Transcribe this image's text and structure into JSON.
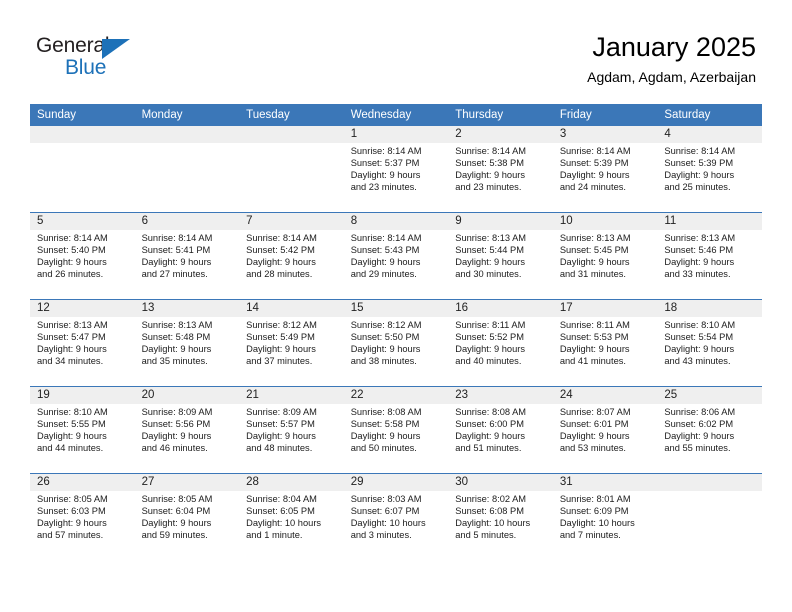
{
  "brand": {
    "name_part1": "General",
    "name_part2": "Blue",
    "triangle_color": "#1d71b8",
    "accent_color": "#3b77b8"
  },
  "header": {
    "title": "January 2025",
    "subtitle": "Agdam, Agdam, Azerbaijan"
  },
  "weekdays": [
    "Sunday",
    "Monday",
    "Tuesday",
    "Wednesday",
    "Thursday",
    "Friday",
    "Saturday"
  ],
  "weeks": [
    [
      {
        "day": "",
        "empty": true
      },
      {
        "day": "",
        "empty": true
      },
      {
        "day": "",
        "empty": true
      },
      {
        "day": "1",
        "sunrise": "Sunrise: 8:14 AM",
        "sunset": "Sunset: 5:37 PM",
        "daylight1": "Daylight: 9 hours",
        "daylight2": "and 23 minutes."
      },
      {
        "day": "2",
        "sunrise": "Sunrise: 8:14 AM",
        "sunset": "Sunset: 5:38 PM",
        "daylight1": "Daylight: 9 hours",
        "daylight2": "and 23 minutes."
      },
      {
        "day": "3",
        "sunrise": "Sunrise: 8:14 AM",
        "sunset": "Sunset: 5:39 PM",
        "daylight1": "Daylight: 9 hours",
        "daylight2": "and 24 minutes."
      },
      {
        "day": "4",
        "sunrise": "Sunrise: 8:14 AM",
        "sunset": "Sunset: 5:39 PM",
        "daylight1": "Daylight: 9 hours",
        "daylight2": "and 25 minutes."
      }
    ],
    [
      {
        "day": "5",
        "sunrise": "Sunrise: 8:14 AM",
        "sunset": "Sunset: 5:40 PM",
        "daylight1": "Daylight: 9 hours",
        "daylight2": "and 26 minutes."
      },
      {
        "day": "6",
        "sunrise": "Sunrise: 8:14 AM",
        "sunset": "Sunset: 5:41 PM",
        "daylight1": "Daylight: 9 hours",
        "daylight2": "and 27 minutes."
      },
      {
        "day": "7",
        "sunrise": "Sunrise: 8:14 AM",
        "sunset": "Sunset: 5:42 PM",
        "daylight1": "Daylight: 9 hours",
        "daylight2": "and 28 minutes."
      },
      {
        "day": "8",
        "sunrise": "Sunrise: 8:14 AM",
        "sunset": "Sunset: 5:43 PM",
        "daylight1": "Daylight: 9 hours",
        "daylight2": "and 29 minutes."
      },
      {
        "day": "9",
        "sunrise": "Sunrise: 8:13 AM",
        "sunset": "Sunset: 5:44 PM",
        "daylight1": "Daylight: 9 hours",
        "daylight2": "and 30 minutes."
      },
      {
        "day": "10",
        "sunrise": "Sunrise: 8:13 AM",
        "sunset": "Sunset: 5:45 PM",
        "daylight1": "Daylight: 9 hours",
        "daylight2": "and 31 minutes."
      },
      {
        "day": "11",
        "sunrise": "Sunrise: 8:13 AM",
        "sunset": "Sunset: 5:46 PM",
        "daylight1": "Daylight: 9 hours",
        "daylight2": "and 33 minutes."
      }
    ],
    [
      {
        "day": "12",
        "sunrise": "Sunrise: 8:13 AM",
        "sunset": "Sunset: 5:47 PM",
        "daylight1": "Daylight: 9 hours",
        "daylight2": "and 34 minutes."
      },
      {
        "day": "13",
        "sunrise": "Sunrise: 8:13 AM",
        "sunset": "Sunset: 5:48 PM",
        "daylight1": "Daylight: 9 hours",
        "daylight2": "and 35 minutes."
      },
      {
        "day": "14",
        "sunrise": "Sunrise: 8:12 AM",
        "sunset": "Sunset: 5:49 PM",
        "daylight1": "Daylight: 9 hours",
        "daylight2": "and 37 minutes."
      },
      {
        "day": "15",
        "sunrise": "Sunrise: 8:12 AM",
        "sunset": "Sunset: 5:50 PM",
        "daylight1": "Daylight: 9 hours",
        "daylight2": "and 38 minutes."
      },
      {
        "day": "16",
        "sunrise": "Sunrise: 8:11 AM",
        "sunset": "Sunset: 5:52 PM",
        "daylight1": "Daylight: 9 hours",
        "daylight2": "and 40 minutes."
      },
      {
        "day": "17",
        "sunrise": "Sunrise: 8:11 AM",
        "sunset": "Sunset: 5:53 PM",
        "daylight1": "Daylight: 9 hours",
        "daylight2": "and 41 minutes."
      },
      {
        "day": "18",
        "sunrise": "Sunrise: 8:10 AM",
        "sunset": "Sunset: 5:54 PM",
        "daylight1": "Daylight: 9 hours",
        "daylight2": "and 43 minutes."
      }
    ],
    [
      {
        "day": "19",
        "sunrise": "Sunrise: 8:10 AM",
        "sunset": "Sunset: 5:55 PM",
        "daylight1": "Daylight: 9 hours",
        "daylight2": "and 44 minutes."
      },
      {
        "day": "20",
        "sunrise": "Sunrise: 8:09 AM",
        "sunset": "Sunset: 5:56 PM",
        "daylight1": "Daylight: 9 hours",
        "daylight2": "and 46 minutes."
      },
      {
        "day": "21",
        "sunrise": "Sunrise: 8:09 AM",
        "sunset": "Sunset: 5:57 PM",
        "daylight1": "Daylight: 9 hours",
        "daylight2": "and 48 minutes."
      },
      {
        "day": "22",
        "sunrise": "Sunrise: 8:08 AM",
        "sunset": "Sunset: 5:58 PM",
        "daylight1": "Daylight: 9 hours",
        "daylight2": "and 50 minutes."
      },
      {
        "day": "23",
        "sunrise": "Sunrise: 8:08 AM",
        "sunset": "Sunset: 6:00 PM",
        "daylight1": "Daylight: 9 hours",
        "daylight2": "and 51 minutes."
      },
      {
        "day": "24",
        "sunrise": "Sunrise: 8:07 AM",
        "sunset": "Sunset: 6:01 PM",
        "daylight1": "Daylight: 9 hours",
        "daylight2": "and 53 minutes."
      },
      {
        "day": "25",
        "sunrise": "Sunrise: 8:06 AM",
        "sunset": "Sunset: 6:02 PM",
        "daylight1": "Daylight: 9 hours",
        "daylight2": "and 55 minutes."
      }
    ],
    [
      {
        "day": "26",
        "sunrise": "Sunrise: 8:05 AM",
        "sunset": "Sunset: 6:03 PM",
        "daylight1": "Daylight: 9 hours",
        "daylight2": "and 57 minutes."
      },
      {
        "day": "27",
        "sunrise": "Sunrise: 8:05 AM",
        "sunset": "Sunset: 6:04 PM",
        "daylight1": "Daylight: 9 hours",
        "daylight2": "and 59 minutes."
      },
      {
        "day": "28",
        "sunrise": "Sunrise: 8:04 AM",
        "sunset": "Sunset: 6:05 PM",
        "daylight1": "Daylight: 10 hours",
        "daylight2": "and 1 minute."
      },
      {
        "day": "29",
        "sunrise": "Sunrise: 8:03 AM",
        "sunset": "Sunset: 6:07 PM",
        "daylight1": "Daylight: 10 hours",
        "daylight2": "and 3 minutes."
      },
      {
        "day": "30",
        "sunrise": "Sunrise: 8:02 AM",
        "sunset": "Sunset: 6:08 PM",
        "daylight1": "Daylight: 10 hours",
        "daylight2": "and 5 minutes."
      },
      {
        "day": "31",
        "sunrise": "Sunrise: 8:01 AM",
        "sunset": "Sunset: 6:09 PM",
        "daylight1": "Daylight: 10 hours",
        "daylight2": "and 7 minutes."
      },
      {
        "day": "",
        "empty": true
      }
    ]
  ]
}
